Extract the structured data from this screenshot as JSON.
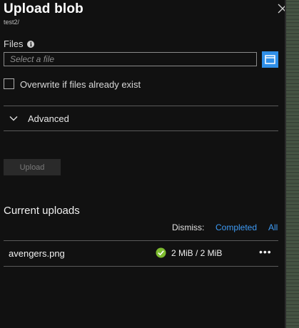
{
  "header": {
    "title": "Upload blob",
    "subtitle": "test2/"
  },
  "files": {
    "label": "Files",
    "placeholder": "Select a file",
    "info_icon": "info-icon",
    "browse_icon": "folder-icon"
  },
  "overwrite": {
    "label": "Overwrite if files already exist",
    "checked": false
  },
  "advanced": {
    "label": "Advanced",
    "expanded": false
  },
  "upload_button": {
    "label": "Upload",
    "enabled": false
  },
  "current_uploads": {
    "title": "Current uploads",
    "dismiss_label": "Dismiss:",
    "dismiss_completed": "Completed",
    "dismiss_all": "All",
    "items": [
      {
        "name": "avengers.png",
        "status": "completed",
        "progress": "2 MiB / 2 MiB"
      }
    ]
  },
  "colors": {
    "accent": "#2f8fe8",
    "link": "#3e9bf5",
    "success": "#7dbb2f",
    "background": "#111111"
  }
}
